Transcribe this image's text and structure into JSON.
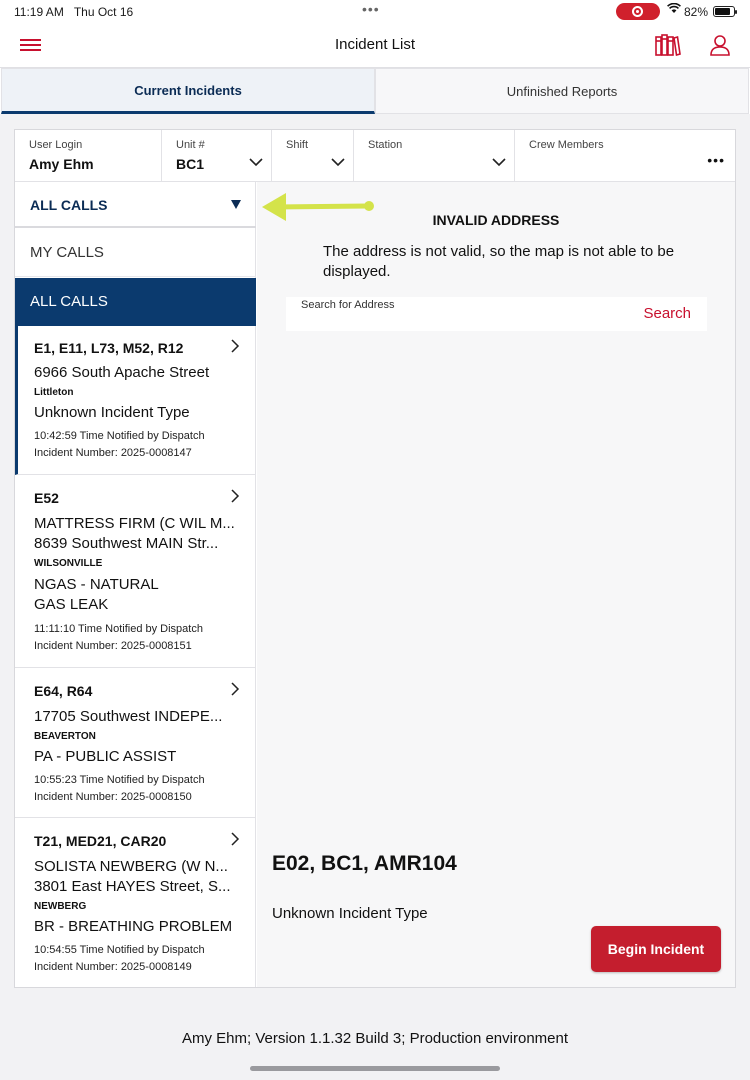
{
  "status": {
    "time": "11:19 AM",
    "date": "Thu Oct 16",
    "battery": "82%"
  },
  "nav": {
    "title": "Incident List"
  },
  "tabs": {
    "current": "Current Incidents",
    "unfinished": "Unfinished Reports"
  },
  "filters": {
    "user_login_label": "User Login",
    "user_login_value": "Amy Ehm",
    "unit_label": "Unit #",
    "unit_value": "BC1",
    "shift_label": "Shift",
    "station_label": "Station",
    "crew_label": "Crew Members"
  },
  "dropdown": {
    "selected": "ALL CALLS",
    "options": [
      "MY CALLS",
      "ALL CALLS"
    ]
  },
  "incidents": [
    {
      "units": "E1, E11, L73, M52, R12",
      "lines": [
        "6966 South Apache Street"
      ],
      "city": "Littleton",
      "type": [
        "Unknown Incident Type"
      ],
      "time": "10:42:59 Time Notified by Dispatch",
      "number": "Incident Number: 2025-0008147"
    },
    {
      "units": "E52",
      "lines": [
        "MATTRESS FIRM (C WIL M...",
        "8639 Southwest MAIN Str..."
      ],
      "city": "WILSONVILLE",
      "type": [
        "NGAS - NATURAL",
        "GAS LEAK"
      ],
      "time": "11:11:10 Time Notified by Dispatch",
      "number": "Incident Number: 2025-0008151"
    },
    {
      "units": "E64, R64",
      "lines": [
        "17705 Southwest INDEPE..."
      ],
      "city": "BEAVERTON",
      "type": [
        "PA - PUBLIC ASSIST"
      ],
      "time": "10:55:23 Time Notified by Dispatch",
      "number": "Incident Number: 2025-0008150"
    },
    {
      "units": "T21, MED21, CAR20",
      "lines": [
        "SOLISTA NEWBERG (W N...",
        "3801 East HAYES Street, S..."
      ],
      "city": "NEWBERG",
      "type": [
        "BR - BREATHING PROBLEM"
      ],
      "time": "10:54:55 Time Notified by Dispatch",
      "number": "Incident Number: 2025-0008149"
    }
  ],
  "main": {
    "invalid_title": "INVALID ADDRESS",
    "invalid_message": "The address is not valid, so the map is not able to be displayed.",
    "search_label": "Search for Address",
    "search_button": "Search",
    "selected_units": "E02, BC1, AMR104",
    "selected_type": "Unknown Incident Type",
    "begin_button": "Begin Incident"
  },
  "footer": "Amy Ehm; Version 1.1.32 Build 3; Production environment",
  "colors": {
    "accent_red": "#c8102e",
    "navy": "#0b3a6e",
    "annotation_arrow": "#d4e34a"
  }
}
